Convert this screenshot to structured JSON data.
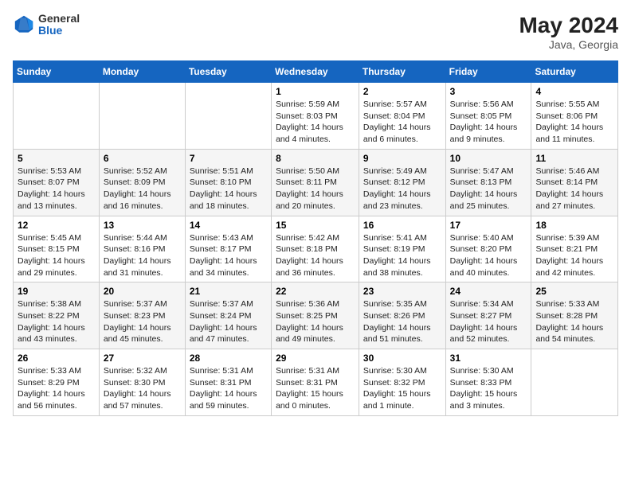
{
  "header": {
    "logo_line1": "General",
    "logo_line2": "Blue",
    "month_year": "May 2024",
    "location": "Java, Georgia"
  },
  "weekdays": [
    "Sunday",
    "Monday",
    "Tuesday",
    "Wednesday",
    "Thursday",
    "Friday",
    "Saturday"
  ],
  "weeks": [
    [
      {
        "day": "",
        "info": ""
      },
      {
        "day": "",
        "info": ""
      },
      {
        "day": "",
        "info": ""
      },
      {
        "day": "1",
        "info": "Sunrise: 5:59 AM\nSunset: 8:03 PM\nDaylight: 14 hours\nand 4 minutes."
      },
      {
        "day": "2",
        "info": "Sunrise: 5:57 AM\nSunset: 8:04 PM\nDaylight: 14 hours\nand 6 minutes."
      },
      {
        "day": "3",
        "info": "Sunrise: 5:56 AM\nSunset: 8:05 PM\nDaylight: 14 hours\nand 9 minutes."
      },
      {
        "day": "4",
        "info": "Sunrise: 5:55 AM\nSunset: 8:06 PM\nDaylight: 14 hours\nand 11 minutes."
      }
    ],
    [
      {
        "day": "5",
        "info": "Sunrise: 5:53 AM\nSunset: 8:07 PM\nDaylight: 14 hours\nand 13 minutes."
      },
      {
        "day": "6",
        "info": "Sunrise: 5:52 AM\nSunset: 8:09 PM\nDaylight: 14 hours\nand 16 minutes."
      },
      {
        "day": "7",
        "info": "Sunrise: 5:51 AM\nSunset: 8:10 PM\nDaylight: 14 hours\nand 18 minutes."
      },
      {
        "day": "8",
        "info": "Sunrise: 5:50 AM\nSunset: 8:11 PM\nDaylight: 14 hours\nand 20 minutes."
      },
      {
        "day": "9",
        "info": "Sunrise: 5:49 AM\nSunset: 8:12 PM\nDaylight: 14 hours\nand 23 minutes."
      },
      {
        "day": "10",
        "info": "Sunrise: 5:47 AM\nSunset: 8:13 PM\nDaylight: 14 hours\nand 25 minutes."
      },
      {
        "day": "11",
        "info": "Sunrise: 5:46 AM\nSunset: 8:14 PM\nDaylight: 14 hours\nand 27 minutes."
      }
    ],
    [
      {
        "day": "12",
        "info": "Sunrise: 5:45 AM\nSunset: 8:15 PM\nDaylight: 14 hours\nand 29 minutes."
      },
      {
        "day": "13",
        "info": "Sunrise: 5:44 AM\nSunset: 8:16 PM\nDaylight: 14 hours\nand 31 minutes."
      },
      {
        "day": "14",
        "info": "Sunrise: 5:43 AM\nSunset: 8:17 PM\nDaylight: 14 hours\nand 34 minutes."
      },
      {
        "day": "15",
        "info": "Sunrise: 5:42 AM\nSunset: 8:18 PM\nDaylight: 14 hours\nand 36 minutes."
      },
      {
        "day": "16",
        "info": "Sunrise: 5:41 AM\nSunset: 8:19 PM\nDaylight: 14 hours\nand 38 minutes."
      },
      {
        "day": "17",
        "info": "Sunrise: 5:40 AM\nSunset: 8:20 PM\nDaylight: 14 hours\nand 40 minutes."
      },
      {
        "day": "18",
        "info": "Sunrise: 5:39 AM\nSunset: 8:21 PM\nDaylight: 14 hours\nand 42 minutes."
      }
    ],
    [
      {
        "day": "19",
        "info": "Sunrise: 5:38 AM\nSunset: 8:22 PM\nDaylight: 14 hours\nand 43 minutes."
      },
      {
        "day": "20",
        "info": "Sunrise: 5:37 AM\nSunset: 8:23 PM\nDaylight: 14 hours\nand 45 minutes."
      },
      {
        "day": "21",
        "info": "Sunrise: 5:37 AM\nSunset: 8:24 PM\nDaylight: 14 hours\nand 47 minutes."
      },
      {
        "day": "22",
        "info": "Sunrise: 5:36 AM\nSunset: 8:25 PM\nDaylight: 14 hours\nand 49 minutes."
      },
      {
        "day": "23",
        "info": "Sunrise: 5:35 AM\nSunset: 8:26 PM\nDaylight: 14 hours\nand 51 minutes."
      },
      {
        "day": "24",
        "info": "Sunrise: 5:34 AM\nSunset: 8:27 PM\nDaylight: 14 hours\nand 52 minutes."
      },
      {
        "day": "25",
        "info": "Sunrise: 5:33 AM\nSunset: 8:28 PM\nDaylight: 14 hours\nand 54 minutes."
      }
    ],
    [
      {
        "day": "26",
        "info": "Sunrise: 5:33 AM\nSunset: 8:29 PM\nDaylight: 14 hours\nand 56 minutes."
      },
      {
        "day": "27",
        "info": "Sunrise: 5:32 AM\nSunset: 8:30 PM\nDaylight: 14 hours\nand 57 minutes."
      },
      {
        "day": "28",
        "info": "Sunrise: 5:31 AM\nSunset: 8:31 PM\nDaylight: 14 hours\nand 59 minutes."
      },
      {
        "day": "29",
        "info": "Sunrise: 5:31 AM\nSunset: 8:31 PM\nDaylight: 15 hours\nand 0 minutes."
      },
      {
        "day": "30",
        "info": "Sunrise: 5:30 AM\nSunset: 8:32 PM\nDaylight: 15 hours\nand 1 minute."
      },
      {
        "day": "31",
        "info": "Sunrise: 5:30 AM\nSunset: 8:33 PM\nDaylight: 15 hours\nand 3 minutes."
      },
      {
        "day": "",
        "info": ""
      }
    ]
  ]
}
